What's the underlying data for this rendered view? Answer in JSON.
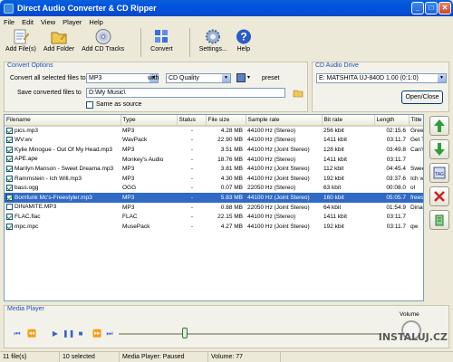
{
  "window": {
    "title": "Direct Audio Converter & CD Ripper"
  },
  "menu": [
    "File",
    "Edit",
    "View",
    "Player",
    "Help"
  ],
  "toolbar": {
    "add_files": "Add File(s)",
    "add_folder": "Add Folder",
    "add_cd_tracks": "Add CD Tracks",
    "convert": "Convert",
    "settings": "Settings...",
    "help": "Help"
  },
  "convert_options": {
    "title": "Convert Options",
    "convert_label": "Convert all selected files to",
    "format_value": "MP3",
    "with_label": "with",
    "quality_value": "CD Quality",
    "preset_label": "preset",
    "save_label": "Save converted files to",
    "save_path": "D:\\My Music\\",
    "same_as_source": "Same as source"
  },
  "cd_drive": {
    "title": "CD Audio Drive",
    "drive_value": "E: MATSHITA UJ-840D 1.00 (0:1:0)",
    "open_close": "Open/Close"
  },
  "table": {
    "columns": [
      "Filename",
      "Type",
      "Status",
      "File size",
      "Sample rate",
      "Bit rate",
      "Length",
      "Title"
    ],
    "rows": [
      {
        "checked": true,
        "filename": "pics.mp3",
        "type": "MP3",
        "status": "-",
        "size": "4.28 MB",
        "rate": "44100 Hz (Stereo)",
        "bitrate": "256 kbit",
        "length": "02:15.6",
        "title": "Green"
      },
      {
        "checked": true,
        "filename": "WV.wv",
        "type": "WavPack",
        "status": "-",
        "size": "22.90 MB",
        "rate": "44100 Hz (Stereo)",
        "bitrate": "1411 kbit",
        "length": "03:11.7",
        "title": "Get T"
      },
      {
        "checked": true,
        "filename": "Kylie Minogue - Out Of My Head.mp3",
        "type": "MP3",
        "status": "-",
        "size": "3.51 MB",
        "rate": "44100 Hz (Joint Stereo)",
        "bitrate": "128 kbit",
        "length": "03:49.8",
        "title": "Can't"
      },
      {
        "checked": true,
        "filename": "APE.ape",
        "type": "Monkey's Audio",
        "status": "-",
        "size": "18.76 MB",
        "rate": "44100 Hz (Stereo)",
        "bitrate": "1411 kbit",
        "length": "03:11.7",
        "title": ""
      },
      {
        "checked": true,
        "filename": "Marilyn Manson - Sweet Dreama.mp3",
        "type": "MP3",
        "status": "-",
        "size": "3.81 MB",
        "rate": "44100 Hz (Joint Stereo)",
        "bitrate": "112 kbit",
        "length": "04:45.4",
        "title": "Swee"
      },
      {
        "checked": true,
        "filename": "Rammstein - Ich Will.mp3",
        "type": "MP3",
        "status": "-",
        "size": "4.30 MB",
        "rate": "44100 Hz (Joint Stereo)",
        "bitrate": "192 kbit",
        "length": "03:37.6",
        "title": "Ich w"
      },
      {
        "checked": true,
        "filename": "bass.ogg",
        "type": "OGG",
        "status": "-",
        "size": "0.07 MB",
        "rate": "22050 Hz (Stereo)",
        "bitrate": "63 kbit",
        "length": "00:08.0",
        "title": "ol"
      },
      {
        "checked": true,
        "filename": "Bomfunk Mc's-Freestyler.mp3",
        "type": "MP3",
        "status": "-",
        "size": "5.83 MB",
        "rate": "44100 Hz (Joint Stereo)",
        "bitrate": "160 kbit",
        "length": "05:05.7",
        "title": "freest",
        "selected": true
      },
      {
        "checked": false,
        "filename": "DINAMITE.MP3",
        "type": "MP3",
        "status": "-",
        "size": "0.88 MB",
        "rate": "22050 Hz (Joint Stereo)",
        "bitrate": "64 kbit",
        "length": "01:54.9",
        "title": "Dinan"
      },
      {
        "checked": true,
        "filename": "FLAC.flac",
        "type": "FLAC",
        "status": "-",
        "size": "22.15 MB",
        "rate": "44100 Hz (Stereo)",
        "bitrate": "1411 kbit",
        "length": "03:11.7",
        "title": ""
      },
      {
        "checked": true,
        "filename": "mpc.mpc",
        "type": "MusePack",
        "status": "-",
        "size": "4.27 MB",
        "rate": "44100 Hz (Joint Stereo)",
        "bitrate": "192 kbit",
        "length": "03:11.7",
        "title": "qw"
      }
    ]
  },
  "player": {
    "title": "Media Player",
    "volume_label": "Volume",
    "seek_fraction": 0.25
  },
  "status": {
    "files": "11 file(s)",
    "selected": "10 selected",
    "player_state": "Media Player: Paused",
    "volume": "Volume: 77"
  },
  "watermark": "INSTALUJ.CZ"
}
